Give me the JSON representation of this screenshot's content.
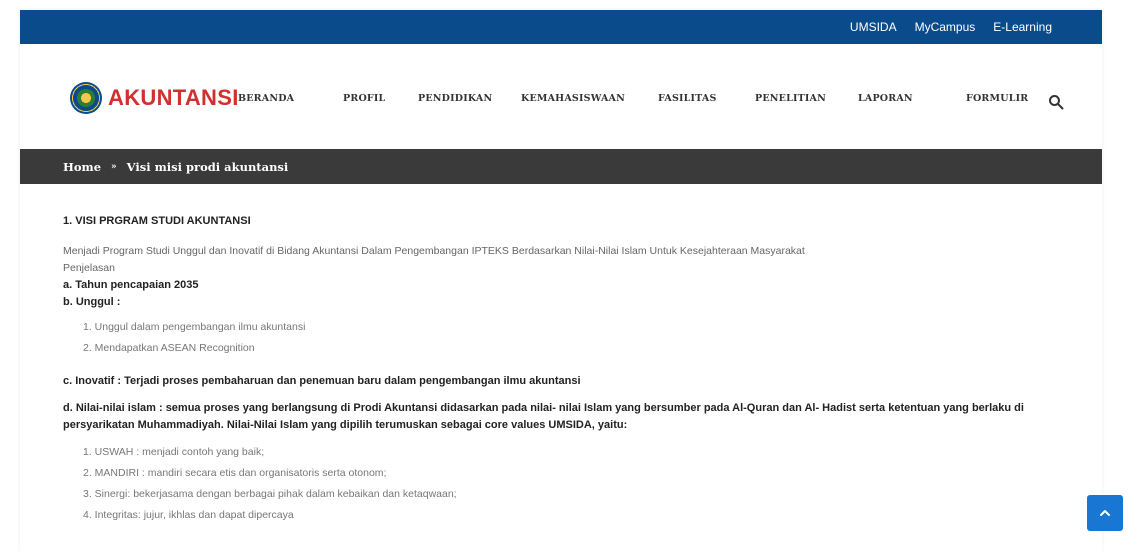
{
  "topbar": {
    "links": [
      "UMSIDA",
      "MyCampus",
      "E-Learning"
    ]
  },
  "header": {
    "logo_text": "AKUNTANSI",
    "nav": [
      "BERANDA",
      "PROFIL",
      "PENDIDIKAN",
      "KEMAHASISWAAN",
      "FASILITAS",
      "PENELITIAN",
      "LAPORAN",
      "FORMULIR"
    ],
    "search_icon": "search-icon"
  },
  "breadcrumb": {
    "home": "Home",
    "separator": "»",
    "current": "Visi misi prodi akuntansi"
  },
  "content": {
    "heading": "1. VISI PRGRAM STUDI AKUNTANSI",
    "vision": "Menjadi Program Studi Unggul dan Inovatif di Bidang Akuntansi Dalam Pengembangan IPTEKS Berdasarkan Nilai-Nilai Islam Untuk Kesejahteraan Masyarakat",
    "penjelasan": "Penjelasan",
    "a_line": "a. Tahun pencapaian 2035",
    "b_line": "b. Unggul :",
    "b_items": [
      "1. Unggul dalam pengembangan ilmu akuntansi",
      "2. Mendapatkan ASEAN Recognition"
    ],
    "c_line": "c. Inovatif : Terjadi proses pembaharuan dan penemuan baru dalam pengembangan ilmu akuntansi",
    "d_line": "d. Nilai-nilai islam : semua proses yang berlangsung di Prodi Akuntansi didasarkan pada nilai- nilai Islam yang bersumber pada Al-Quran dan Al- Hadist serta ketentuan yang berlaku di persyarikatan Muhammadiyah. Nilai-Nilai Islam yang dipilih terumuskan sebagai core values UMSIDA, yaitu:",
    "d_items": [
      "1. USWAH : menjadi contoh yang baik;",
      "2. MANDIRI : mandiri secara etis dan organisatoris serta otonom;",
      "3. Sinergi: bekerjasama dengan berbagai pihak dalam kebaikan dan ketaqwaan;",
      "4. Integritas: jujur, ikhlas dan dapat dipercaya"
    ]
  },
  "scroll_top_icon": "chevron-up-icon",
  "colors": {
    "topbar": "#0a4b8c",
    "logo_text": "#d32f2f",
    "breadcrumb_bg": "#3a3a3a",
    "scroll_button": "#1976d2"
  }
}
